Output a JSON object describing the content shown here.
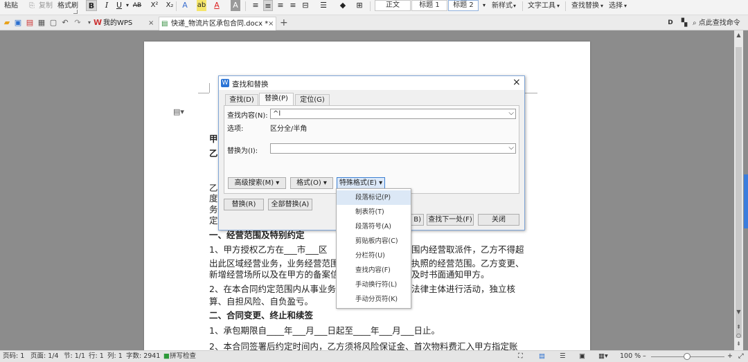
{
  "ribbon": {
    "paste": "粘贴",
    "copy": "复制",
    "format_painter": "格式刷",
    "bold": "B",
    "italic": "I",
    "underline": "U",
    "strike": "AB",
    "superscript": "X²",
    "subscript": "X₂",
    "text_effect": "A",
    "highlight": "ab",
    "font_color": "A",
    "char_shade": "A",
    "styles": [
      "正文",
      "标题 1",
      "标题 2"
    ],
    "new_style": "新样式",
    "text_tools": "文字工具",
    "find_replace": "查找替换",
    "select": "选择"
  },
  "tabs": [
    {
      "label": "我的WPS",
      "close": "×"
    },
    {
      "label": "快递_物流片区承包合同.docx *",
      "close": "×"
    }
  ],
  "new_tab": "+",
  "search_command": "点此查找命令",
  "document": {
    "line_jia": "甲",
    "line_yi": "乙",
    "line_yi2": "乙",
    "line_du": "度",
    "line_wu": "务",
    "line_ding": "定",
    "section1": "一、经营范围及特别约定",
    "p1_a": "1、甲方授权乙方在___市___区",
    "p1_b": "围内经营取派件，乙方不得超",
    "p2_a": "出此区域经营业务，业务经营范围",
    "p2_b": "执照的经营范围。乙方变更、",
    "p3_a": "新增经营场所以及在甲方的备案信",
    "p3_b": "及时书面通知甲方。",
    "p4_a": "2、在本合同约定范围内从事业务",
    "p4_b": "法律主体进行活动，独立核",
    "p5": "算、自担风险、自负盈亏。",
    "section2": "二、合同变更、终止和续签",
    "p6": "1、承包期限自____年___月___日起至____年___月___日止。",
    "p7": "2、本合同签署后约定时间内，乙方须将风险保证金、首次物料费汇入甲方指定账"
  },
  "dialog": {
    "title": "查找和替换",
    "close": "×",
    "tabs": [
      "查找(D)",
      "替换(P)",
      "定位(G)"
    ],
    "find_label": "查找内容(N):",
    "find_value": "^l",
    "options_label": "选项:",
    "options_value": "区分全/半角",
    "replace_label": "替换为(I):",
    "replace_value": "",
    "advanced_btn": "高级搜索(M) ▾",
    "format_btn": "格式(O) ▾",
    "special_btn": "特殊格式(E) ▾",
    "replace_btn": "替换(R)",
    "replace_all_btn": "全部替换(A)",
    "find_prev_btn_fragment": "B)",
    "find_next_btn": "查找下一处(F)",
    "close_btn": "关闭"
  },
  "special_menu": [
    "段落标记(P)",
    "制表符(T)",
    "段落符号(A)",
    "剪贴板内容(C)",
    "分栏符(U)",
    "查找内容(F)",
    "手动换行符(L)",
    "手动分页符(K)"
  ],
  "status": {
    "page_num": "页码: 1",
    "pages": "页面: 1/4",
    "section": "节: 1/1",
    "row": "行: 1",
    "col": "列: 1",
    "words": "字数: 2941",
    "spell": "拼写检查",
    "zoom": "100 %"
  },
  "colors": {
    "accent": "#3b7ddd",
    "dialog_border": "#7fa6d8",
    "menu_hover": "#dce8f6"
  }
}
